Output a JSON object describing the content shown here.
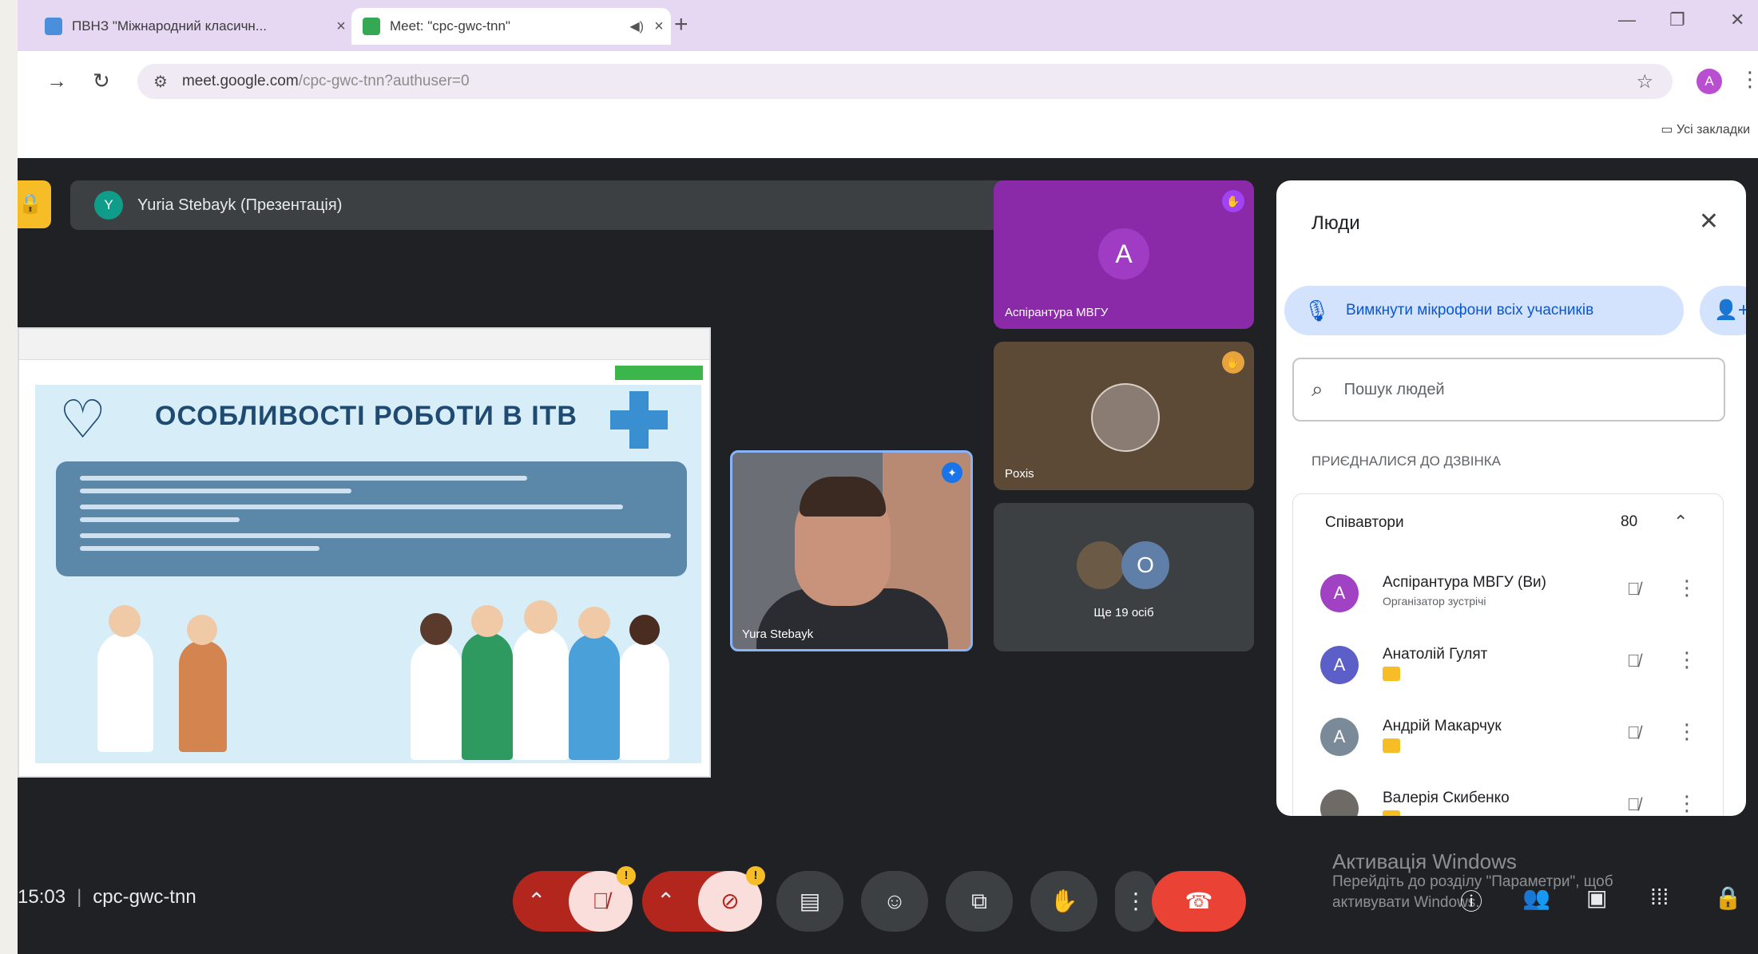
{
  "browser": {
    "tabs": [
      {
        "title": "ПВНЗ \"Міжнародний класичн...",
        "active": false
      },
      {
        "title": "Meet: \"cpc-gwc-tnn\"",
        "active": true
      }
    ],
    "url": "meet.google.com",
    "url_rest": "/cpc-gwc-tnn?authuser=0",
    "profile_initial": "A",
    "all_bookmarks": "Усі закладки"
  },
  "meeting": {
    "presenter_bar": "Yuria Stebayk (Презентація)",
    "presenter_initial": "Y",
    "slide": {
      "title": "ОСОБЛИВОСТІ РОБОТИ В ІТВ"
    },
    "self_view_name": "Yura Stebayk",
    "tiles": [
      {
        "label": "Аспірантура МВГУ",
        "initial": "A"
      },
      {
        "label": "Poxis",
        "initial": ""
      },
      {
        "label": "Ще 19 осіб",
        "initial": "O"
      }
    ],
    "time": "15:03",
    "code": "cpc-gwc-tnn"
  },
  "people_panel": {
    "title": "Люди",
    "mute_all": "Вимкнути мікрофони всіх учасників",
    "search_placeholder": "Пошук людей",
    "section": "ПРИЄДНАЛИСЯ ДО ДЗВІНКА",
    "group_name": "Співавтори",
    "group_count": "80",
    "people": [
      {
        "name": "Аспірантура МВГУ (Ви)",
        "subtitle": "Організатор зустрічі",
        "initial": "A",
        "color": "#a142c4"
      },
      {
        "name": "Анатолій Гулят",
        "subtitle": "",
        "initial": "A",
        "color": "#5b5fc7"
      },
      {
        "name": "Андрій Макарчук",
        "subtitle": "",
        "initial": "A",
        "color": "#7a8a99"
      },
      {
        "name": "Валерія Скибенко",
        "subtitle": "",
        "initial": "",
        "color": "#6e6a66"
      }
    ]
  },
  "windows_watermark": {
    "line1": "Активація Windows",
    "line2": "Перейдіть до розділу \"Параметри\", щоб",
    "line3": "активувати Windows."
  }
}
